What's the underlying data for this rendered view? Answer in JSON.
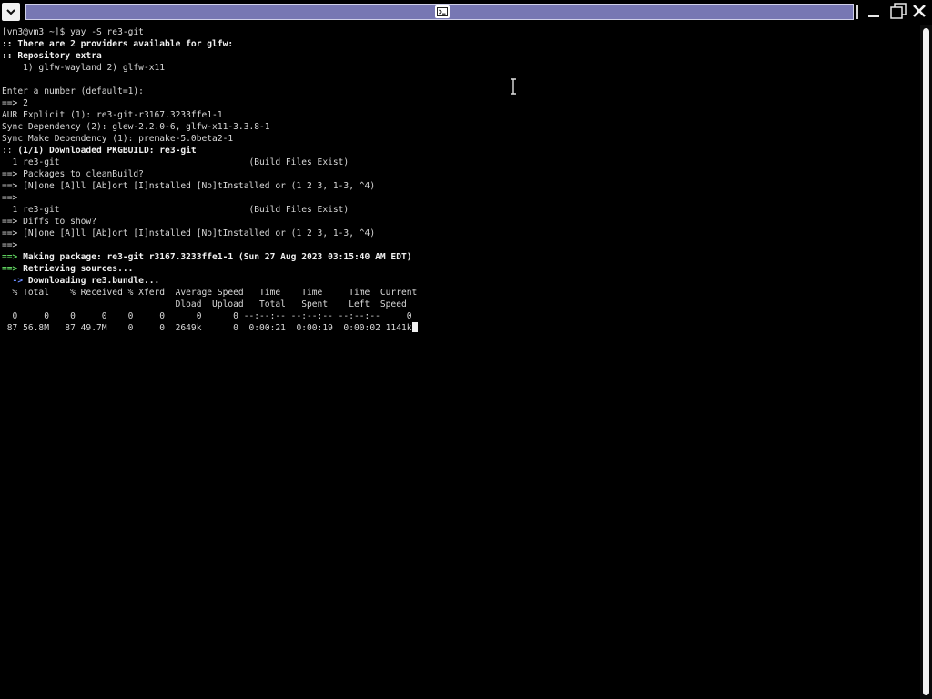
{
  "window": {
    "menu_icon": "chevron-down-icon",
    "terminal_icon": "terminal-icon",
    "controls": [
      "minimize-icon",
      "maximize-icon",
      "close-icon"
    ]
  },
  "terminal": {
    "lines": {
      "l0": "[vm3@vm3 ~]$ yay -S re3-git",
      "l1": ":: There are 2 providers available for glfw:",
      "l2": ":: Repository extra",
      "l3": "    1) glfw-wayland 2) glfw-x11",
      "l4": "",
      "l5": "Enter a number (default=1):",
      "l6": "==> 2",
      "l7": "AUR Explicit (1): re3-git-r3167.3233ffe1-1",
      "l8": "Sync Dependency (2): glew-2.2.0-6, glfw-x11-3.3.8-1",
      "l9": "Sync Make Dependency (1): premake-5.0beta2-1",
      "l10_prefix": ":: ",
      "l10_text": "(1/1) Downloaded PKGBUILD: re3-git",
      "l11": "  1 re3-git                                    (Build Files Exist)",
      "l12": "==> Packages to cleanBuild?",
      "l13": "==> [N]one [A]ll [Ab]ort [I]nstalled [No]tInstalled or (1 2 3, 1-3, ^4)",
      "l14": "==>",
      "l15": "  1 re3-git                                    (Build Files Exist)",
      "l16": "==> Diffs to show?",
      "l17": "==> [N]one [A]ll [Ab]ort [I]nstalled [No]tInstalled or (1 2 3, 1-3, ^4)",
      "l18": "==>",
      "l19_arrow": "==>",
      "l19_text": " Making package: re3-git r3167.3233ffe1-1 (Sun 27 Aug 2023 03:15:40 AM EDT)",
      "l20_arrow": "==>",
      "l20_text": " Retrieving sources...",
      "l21_arrow": "  ->",
      "l21_text": " Downloading re3.bundle...",
      "l22": "  % Total    % Received % Xferd  Average Speed   Time    Time     Time  Current",
      "l23": "                                 Dload  Upload   Total   Spent    Left  Speed",
      "l24": "  0     0    0     0    0     0      0      0 --:--:-- --:--:-- --:--:--     0",
      "l25": " 87 56.8M   87 49.7M    0     0  2649k      0  0:00:21  0:00:19  0:00:02 1141k"
    }
  }
}
